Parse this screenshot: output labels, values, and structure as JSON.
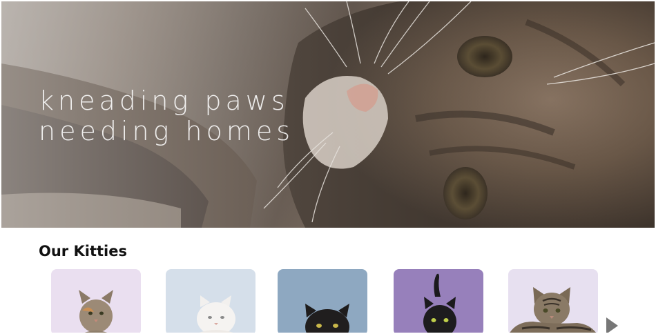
{
  "hero": {
    "line1": "kneading paws",
    "line2": "needing homes"
  },
  "section": {
    "title": "Our Kitties"
  },
  "kitties": [
    {
      "bg": "#eadff0",
      "fur": "tabby-calico"
    },
    {
      "bg": "#d5dfea",
      "fur": "white"
    },
    {
      "bg": "#8ea8c1",
      "fur": "black"
    },
    {
      "bg": "#9780bb",
      "fur": "black"
    },
    {
      "bg": "#e7e0f0",
      "fur": "tabby"
    }
  ],
  "next_icon": "chevron-right-icon"
}
